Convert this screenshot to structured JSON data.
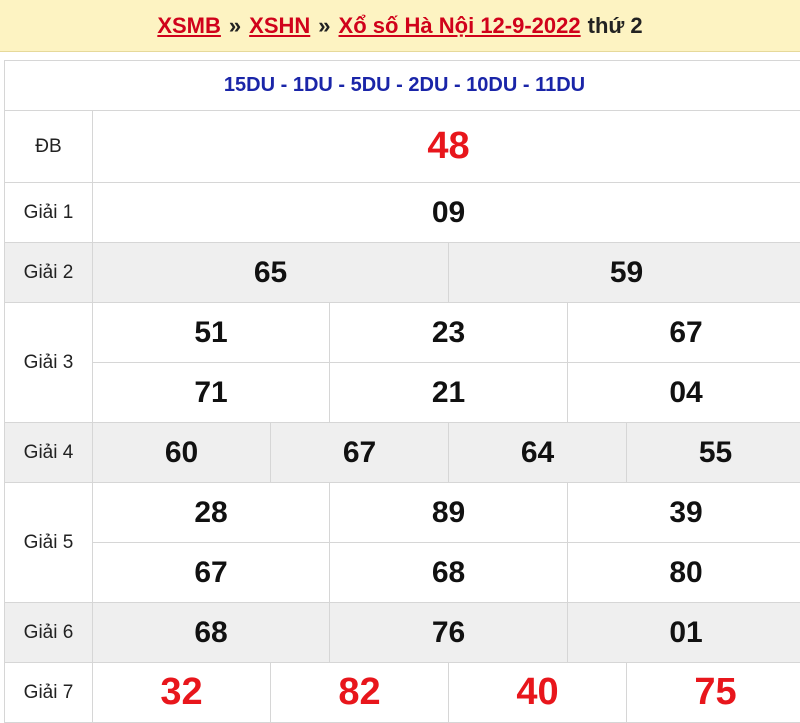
{
  "breadcrumb": {
    "items": [
      "XSMB",
      "XSHN",
      "Xổ số Hà Nội 12-9-2022"
    ],
    "separator": "»",
    "day": "thứ 2"
  },
  "codes": "15DU - 1DU - 5DU - 2DU - 10DU - 11DU",
  "prizes": {
    "db": {
      "label": "ĐB",
      "numbers": [
        "48"
      ]
    },
    "g1": {
      "label": "Giải 1",
      "numbers": [
        "09"
      ]
    },
    "g2": {
      "label": "Giải 2",
      "numbers": [
        "65",
        "59"
      ]
    },
    "g3": {
      "label": "Giải 3",
      "numbers": [
        "51",
        "23",
        "67",
        "71",
        "21",
        "04"
      ]
    },
    "g4": {
      "label": "Giải 4",
      "numbers": [
        "60",
        "67",
        "64",
        "55"
      ]
    },
    "g5": {
      "label": "Giải 5",
      "numbers": [
        "28",
        "89",
        "39",
        "67",
        "68",
        "80"
      ]
    },
    "g6": {
      "label": "Giải 6",
      "numbers": [
        "68",
        "76",
        "01"
      ]
    },
    "g7": {
      "label": "Giải 7",
      "numbers": [
        "32",
        "82",
        "40",
        "75"
      ]
    }
  },
  "colors": {
    "accent_red": "#e8161c",
    "code_blue": "#1a25a8",
    "header_bg": "#fdf3c2"
  }
}
